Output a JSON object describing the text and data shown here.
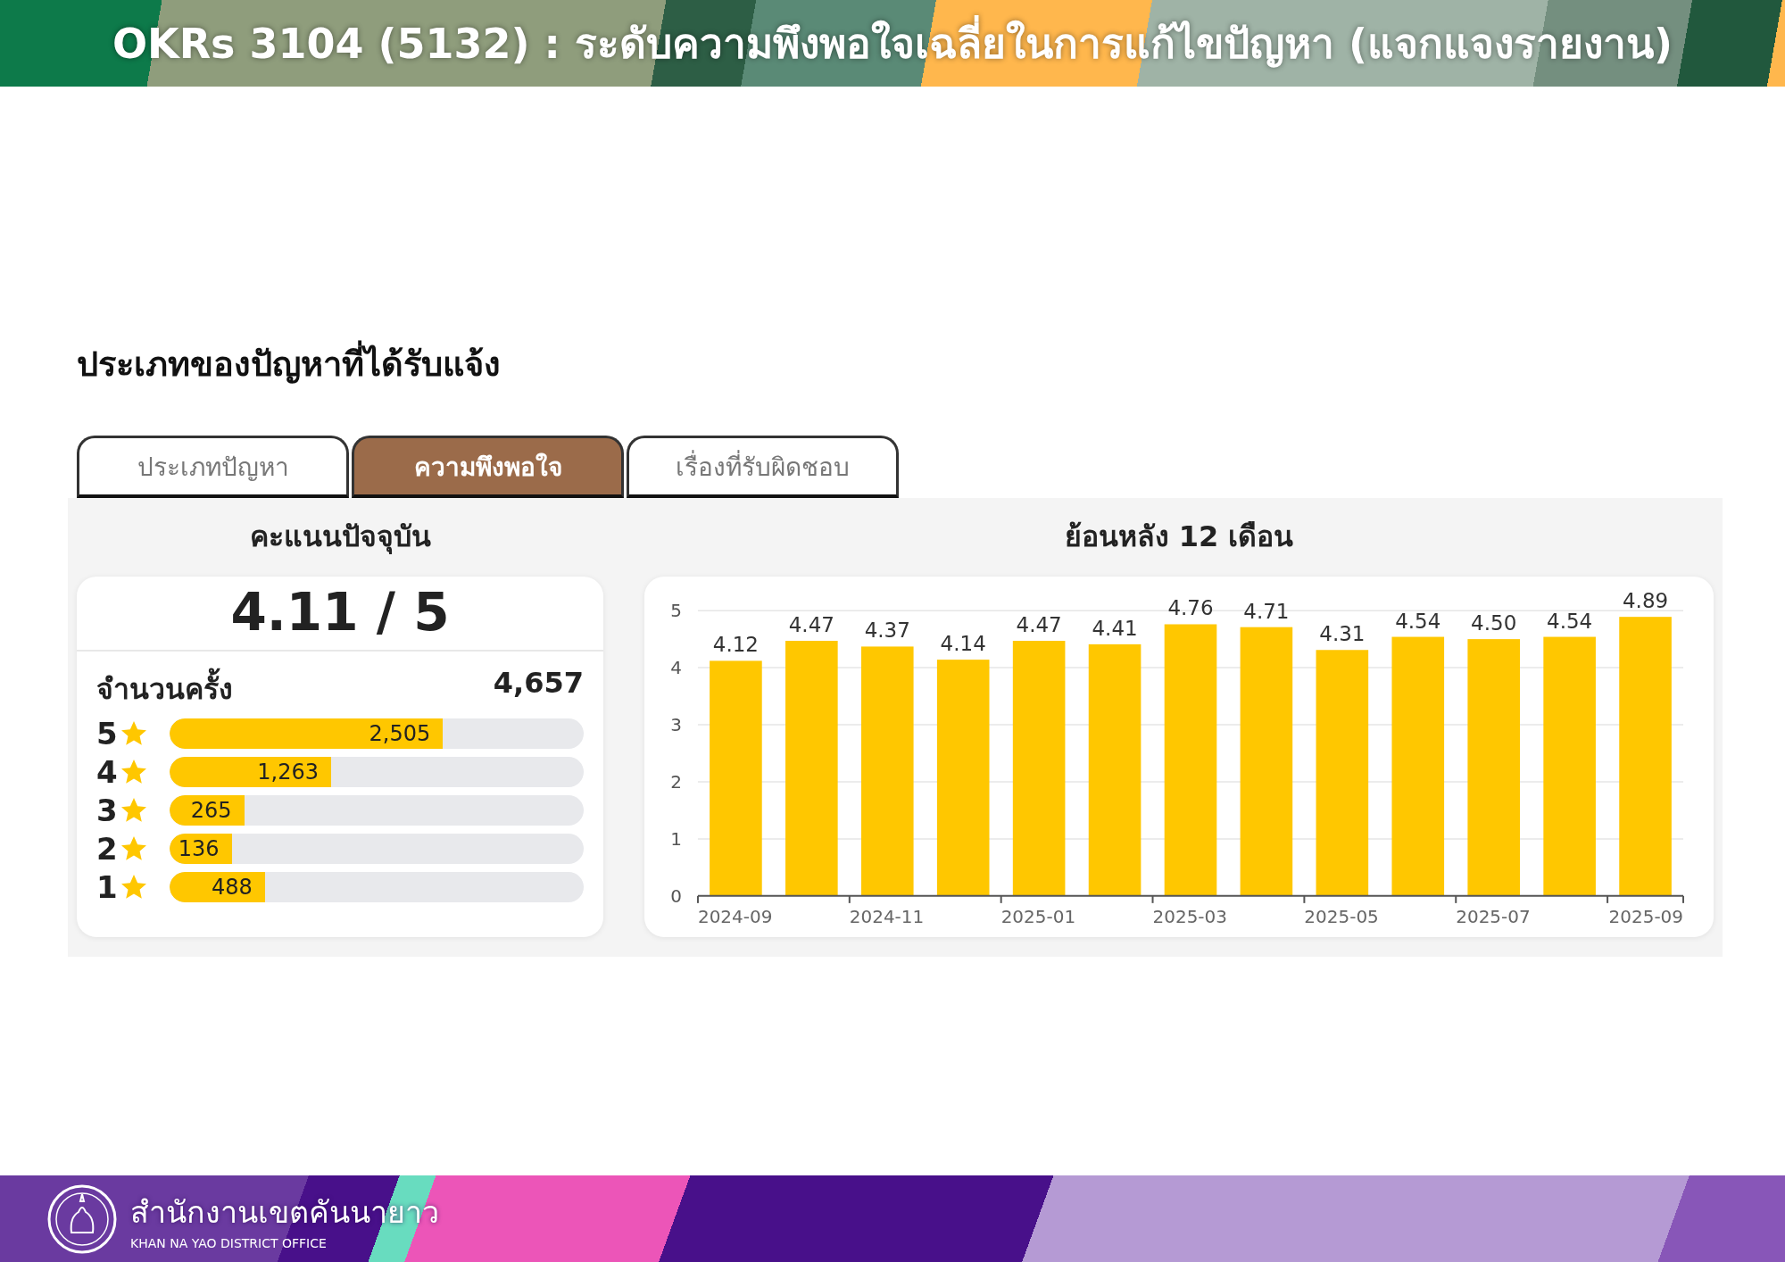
{
  "header": {
    "title": "OKRs 3104 (5132) : ระดับความพึงพอใจเฉลี่ยในการแก้ไขปัญหา (แจกแจงรายงาน)"
  },
  "section_title": "ประเภทของปัญหาที่ได้รับแจ้ง",
  "tabs": [
    {
      "label": "ประเภทปัญหา",
      "selected": false
    },
    {
      "label": "ความพึงพอใจ",
      "selected": true
    },
    {
      "label": "เรื่องที่รับผิดชอบ",
      "selected": false
    }
  ],
  "current_score": {
    "heading": "คะแนนปัจจุบัน",
    "score": "4.11 / 5",
    "count_label": "จำนวนครั้ง",
    "count": "4,657",
    "ratings": [
      {
        "label": "5",
        "count": "2,505",
        "level": 0.66
      },
      {
        "label": "4",
        "count": "1,263",
        "level": 0.39
      },
      {
        "label": "3",
        "count": "265",
        "level": 0.18
      },
      {
        "label": "2",
        "count": "136",
        "level": 0.15
      },
      {
        "label": "1",
        "count": "488",
        "level": 0.23
      }
    ]
  },
  "trend": {
    "heading": "ย้อนหลัง 12 เดือน",
    "chart_data": {
      "type": "bar",
      "categories": [
        "2024-09",
        null,
        "2024-11",
        null,
        "2025-01",
        null,
        "2025-03",
        null,
        "2025-05",
        null,
        "2025-07",
        null,
        "2025-09"
      ],
      "series": [
        {
          "color": "#ffc700",
          "values": [
            4.12,
            4.47,
            4.37,
            4.14,
            4.47,
            4.41,
            4.76,
            4.71,
            4.31,
            4.54,
            4.5,
            4.54,
            4.89
          ]
        }
      ],
      "ylim": [
        0,
        5
      ],
      "yticks": [
        0,
        1,
        2,
        3,
        4,
        5
      ],
      "grid": true,
      "value_labels": [
        "4.12",
        "4.47",
        "4.37",
        "4.14",
        "4.47",
        "4.41",
        "4.76",
        "4.71",
        "4.31",
        "4.54",
        "4.50",
        "4.54",
        "4.89"
      ]
    }
  },
  "footer": {
    "org_name": "สำนักงานเขตคันนายาว",
    "org_name_en": "KHAN NA YAO DISTRICT OFFICE"
  }
}
